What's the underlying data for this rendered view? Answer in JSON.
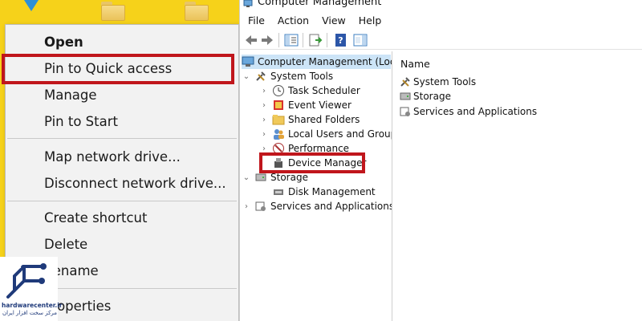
{
  "context_menu": {
    "items": [
      {
        "label": "Open"
      },
      {
        "label": "Pin to Quick access"
      },
      {
        "label": "Manage"
      },
      {
        "label": "Pin to Start"
      },
      {
        "label": "Map network drive..."
      },
      {
        "label": "Disconnect network drive..."
      },
      {
        "label": "Create shortcut"
      },
      {
        "label": "Delete"
      },
      {
        "label": "Rename"
      },
      {
        "label": "Properties"
      }
    ],
    "highlight_color": "#c0161c"
  },
  "logo": {
    "brand": "hardwarecenter.ir",
    "tagline": "مرکز سخت افزار ایران",
    "color": "#1f3a7a"
  },
  "window": {
    "title": "Computer Management",
    "menu": [
      "File",
      "Action",
      "View",
      "Help"
    ],
    "tree": {
      "root": "Computer Management (Local",
      "system_tools": "System Tools",
      "task_scheduler": "Task Scheduler",
      "event_viewer": "Event Viewer",
      "shared_folders": "Shared Folders",
      "local_users": "Local Users and Groups",
      "performance": "Performance",
      "device_manager": "Device Manager",
      "storage": "Storage",
      "disk_management": "Disk Management",
      "services": "Services and Applications"
    },
    "right_pane": {
      "column": "Name",
      "items": [
        "System Tools",
        "Storage",
        "Services and Applications"
      ]
    },
    "selection_color": "#cce4f7"
  }
}
